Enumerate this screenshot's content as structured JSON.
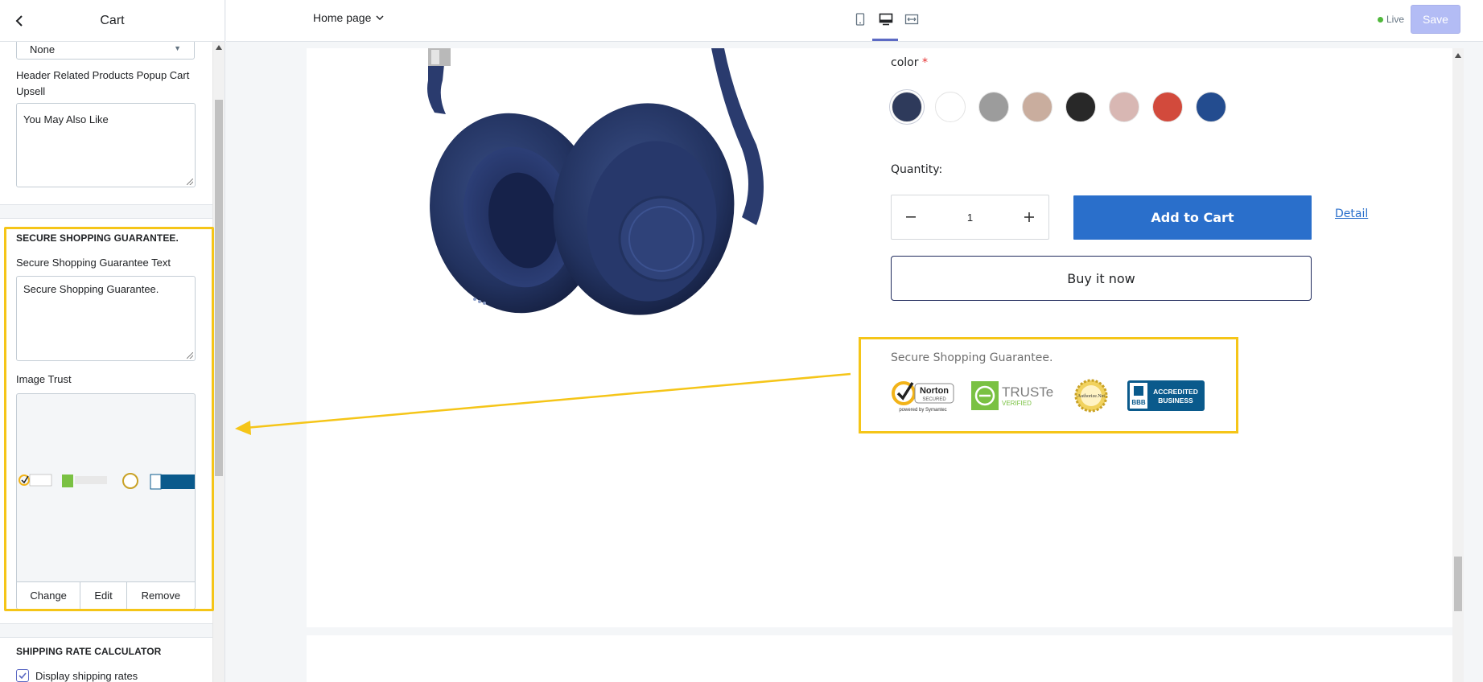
{
  "sidebar": {
    "title": "Cart",
    "select_value": "None",
    "upsell_label": "Header Related Products Popup Cart Upsell",
    "upsell_value": "You May Also Like",
    "guarantee_section_title": "SECURE SHOPPING GUARANTEE.",
    "guarantee_text_label": "Secure Shopping Guarantee Text",
    "guarantee_text_value": "Secure Shopping Guarantee.",
    "image_trust_label": "Image Trust",
    "image_buttons": {
      "change": "Change",
      "edit": "Edit",
      "remove": "Remove"
    },
    "shipping_section_title": "SHIPPING RATE CALCULATOR",
    "display_shipping_label": "Display shipping rates",
    "display_shipping_checked": true
  },
  "topbar": {
    "page_select": "Home page",
    "live_label": "Live",
    "save_label": "Save",
    "active_view": "desktop",
    "views": [
      "mobile-icon",
      "desktop-icon",
      "full-width-icon"
    ]
  },
  "product": {
    "color_label": "color",
    "required_marker": "*",
    "swatches": [
      "#2e3a5b",
      "#ffffff",
      "#9c9c9c",
      "#c9ad9e",
      "#282828",
      "#d8b7b3",
      "#d24a3c",
      "#234c8f"
    ],
    "selected_swatch": 0,
    "quantity_label": "Quantity:",
    "quantity_value": "1",
    "add_to_cart": "Add to Cart",
    "detail_link": "Detail",
    "buy_now": "Buy it now",
    "guarantee_text": "Secure Shopping Guarantee.",
    "trust_badges": {
      "norton": {
        "name": "Norton",
        "line2": "SECURED",
        "line3": "powered by Symantec"
      },
      "truste": {
        "name": "TRUSTe",
        "line2": "VERIFIED"
      },
      "authorize": {
        "name": "Authorize.Net"
      },
      "bbb": {
        "name": "BBB",
        "line1": "ACCREDITED",
        "line2": "BUSINESS"
      }
    }
  },
  "colors": {
    "accent": "#5c6ac4",
    "highlight": "#f5c518",
    "primary_button": "#2a6fcb",
    "live_dot": "#50b83c"
  }
}
